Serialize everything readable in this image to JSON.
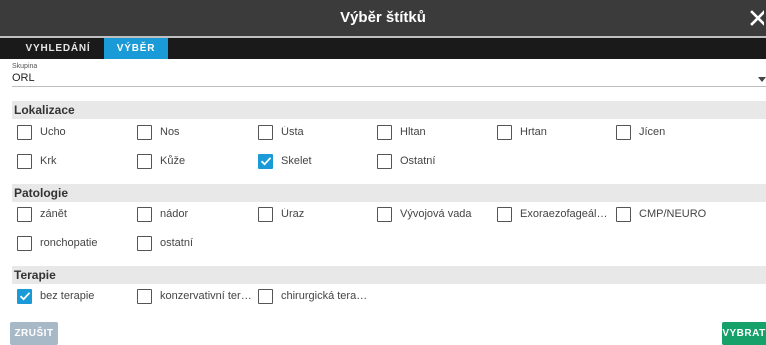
{
  "dialog": {
    "title": "Výběr štítků",
    "tabs": [
      {
        "label": "VYHLEDÁNÍ",
        "active": false
      },
      {
        "label": "VÝBĚR",
        "active": true
      }
    ]
  },
  "group_select": {
    "label": "Skupina",
    "value": "ORL"
  },
  "sections": [
    {
      "heading": "Lokalizace",
      "items": [
        {
          "label": "Ucho",
          "checked": false
        },
        {
          "label": "Nos",
          "checked": false
        },
        {
          "label": "Ústa",
          "checked": false
        },
        {
          "label": "Hltan",
          "checked": false
        },
        {
          "label": "Hrtan",
          "checked": false
        },
        {
          "label": "Jícen",
          "checked": false
        },
        {
          "label": "Krk",
          "checked": false
        },
        {
          "label": "Kůže",
          "checked": false
        },
        {
          "label": "Skelet",
          "checked": true
        },
        {
          "label": "Ostatní",
          "checked": false
        }
      ]
    },
    {
      "heading": "Patologie",
      "items": [
        {
          "label": "zánět",
          "checked": false
        },
        {
          "label": "nádor",
          "checked": false
        },
        {
          "label": "Úraz",
          "checked": false
        },
        {
          "label": "Vývojová vada",
          "checked": false
        },
        {
          "label": "Exoraezofageáln…",
          "checked": false
        },
        {
          "label": "CMP/NEURO",
          "checked": false
        },
        {
          "label": "ronchopatie",
          "checked": false
        },
        {
          "label": "ostatní",
          "checked": false
        }
      ]
    },
    {
      "heading": "Terapie",
      "items": [
        {
          "label": "bez terapie",
          "checked": true
        },
        {
          "label": "konzervativní ter…",
          "checked": false
        },
        {
          "label": "chirurgická tera…",
          "checked": false
        }
      ]
    }
  ],
  "actions": {
    "cancel_label": "ZRUŠIT",
    "confirm_label": "VYBRAT"
  },
  "colors": {
    "accent": "#1a9ad6",
    "confirm": "#16a06a",
    "cancel": "#a7b9c7",
    "titlebar": "#3b3b3b"
  }
}
